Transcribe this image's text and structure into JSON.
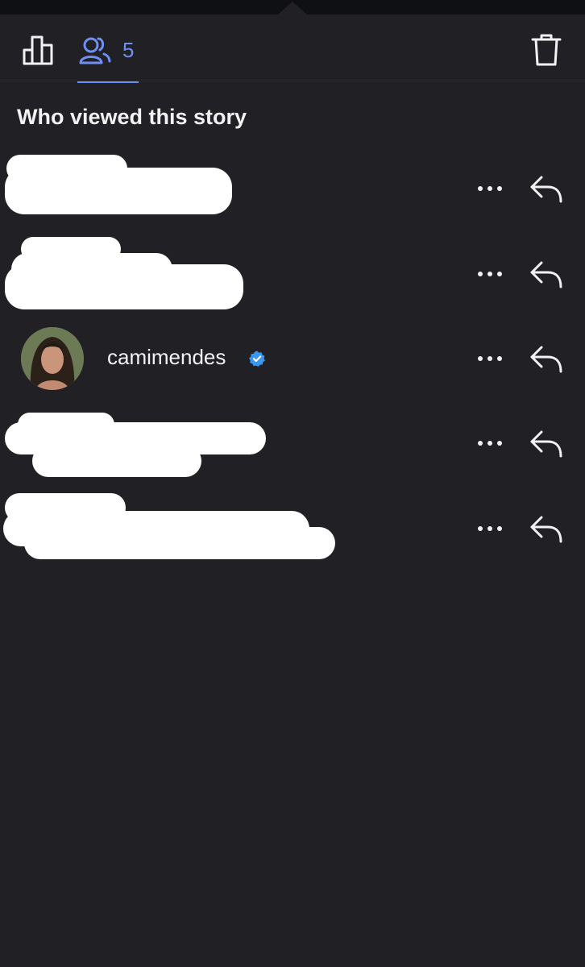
{
  "tabs": {
    "stats_icon": "bar-chart-icon",
    "viewers_icon": "people-icon",
    "viewers_count": "5",
    "delete_icon": "trash-icon"
  },
  "section_title": "Who viewed this story",
  "viewers": [
    {
      "username": "",
      "redacted": true
    },
    {
      "username": "",
      "redacted": true
    },
    {
      "username": "camimendes",
      "redacted": false,
      "verified": true
    },
    {
      "username": "",
      "redacted": true
    },
    {
      "username": "",
      "redacted": true
    }
  ],
  "row_actions": {
    "more_icon": "more-dots-icon",
    "reply_icon": "reply-arrow-icon"
  },
  "colors": {
    "background": "#202025",
    "accent": "#6f8ff2",
    "verified": "#3897f0",
    "text": "#f2f2f2"
  }
}
